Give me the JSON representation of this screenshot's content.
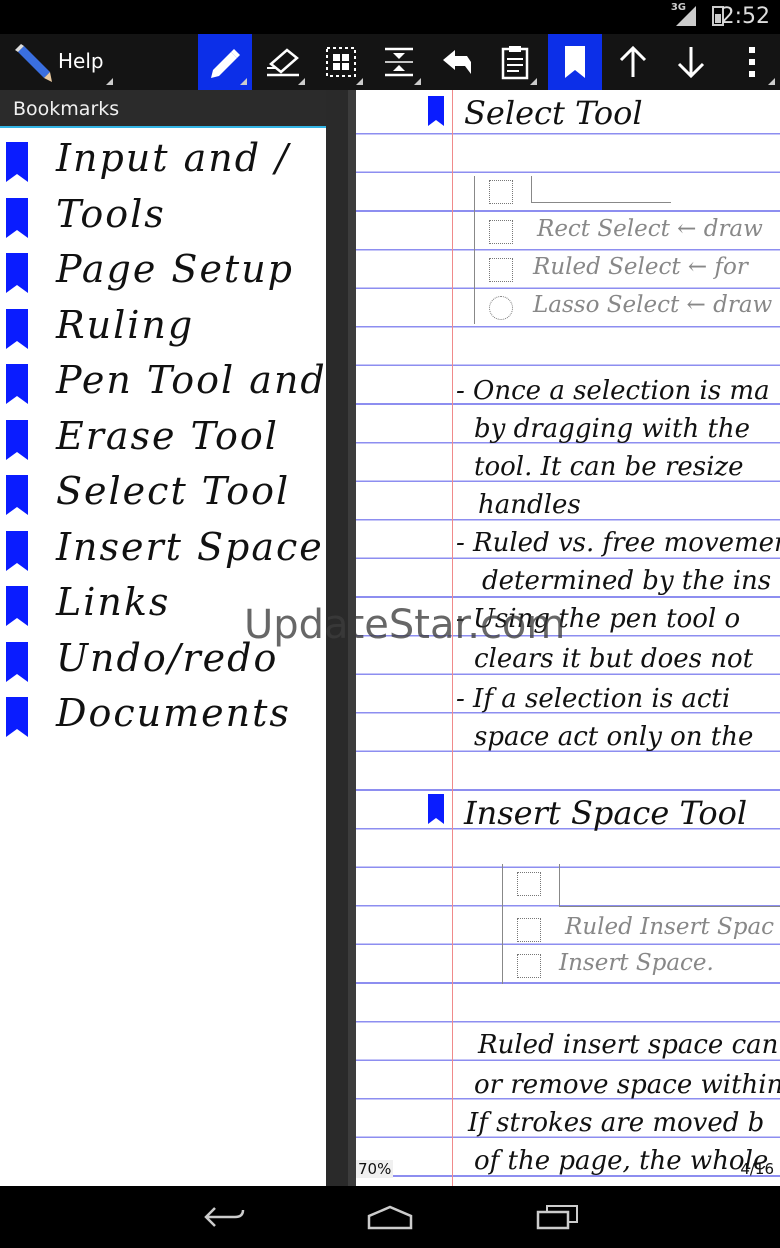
{
  "status_bar": {
    "network": "3G",
    "time": "2:52"
  },
  "toolbar": {
    "title": "Help",
    "tools": [
      {
        "icon": "pen-icon",
        "active": true
      },
      {
        "icon": "eraser-icon",
        "active": false
      },
      {
        "icon": "select-icon",
        "active": false
      },
      {
        "icon": "insert-space-icon",
        "active": false
      },
      {
        "icon": "undo-icon",
        "active": false
      },
      {
        "icon": "clipboard-icon",
        "active": false
      },
      {
        "icon": "bookmark-icon",
        "active": true
      },
      {
        "icon": "arrow-up-icon",
        "active": false
      },
      {
        "icon": "arrow-down-icon",
        "active": false
      },
      {
        "icon": "overflow-menu-icon",
        "active": false
      }
    ]
  },
  "bookmarks": {
    "header": "Bookmarks",
    "items": [
      {
        "label": "Input and /"
      },
      {
        "label": "Tools"
      },
      {
        "label": "Page Setup"
      },
      {
        "label": "Ruling"
      },
      {
        "label": "Pen Tool and Boo"
      },
      {
        "label": "Erase Tool"
      },
      {
        "label": "Select Tool"
      },
      {
        "label": "Insert Space"
      },
      {
        "label": "Links"
      },
      {
        "label": "Undo/redo"
      },
      {
        "label": "Documents"
      }
    ]
  },
  "page": {
    "select_heading": "Select Tool",
    "select_options": [
      "Rect Select ← draw",
      "Ruled Select ← for",
      "Lasso Select ← draw"
    ],
    "select_notes": [
      "- Once a selection is ma",
      "by dragging with the",
      "tool. It can be resize",
      "handles",
      "- Ruled vs. free movement",
      "determined by the ins",
      "- Using the pen tool o",
      "clears it but does not",
      "- If a selection is acti",
      "space act only on the"
    ],
    "insert_heading": "Insert Space Tool",
    "insert_options": [
      "Ruled Insert Spac",
      "Insert Space."
    ],
    "insert_notes": [
      "Ruled insert space can",
      "or remove space within",
      "If strokes are moved b",
      "of the page, the whole"
    ],
    "zoom": "70%",
    "page_number": "4/16"
  },
  "watermark": "UpdateStar.com",
  "colors": {
    "accent": "#0c2fe8",
    "bookmark_flag": "#0a1cff",
    "rule_line": "#8d8ef0",
    "margin_line": "#f08a8a",
    "header_underline": "#33b5e5"
  },
  "nav_bar": {
    "buttons": [
      "back-icon",
      "home-icon",
      "recents-icon"
    ]
  }
}
